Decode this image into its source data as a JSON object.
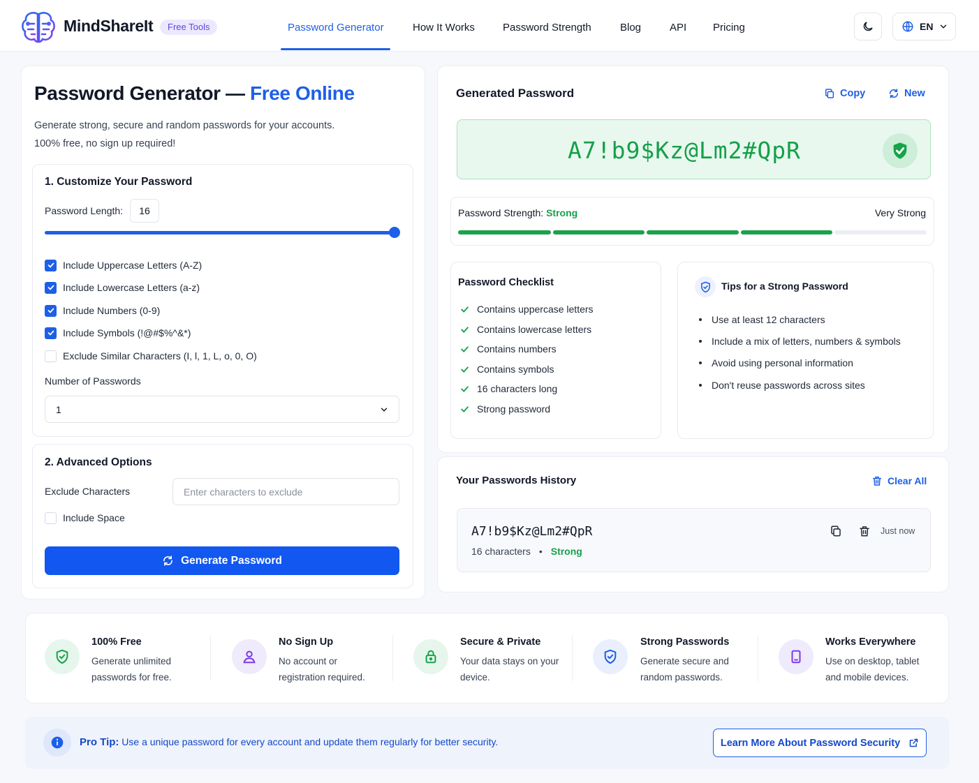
{
  "header": {
    "brand": "MindShareIt",
    "badge": "Free Tools",
    "nav": [
      "Password Generator",
      "How It Works",
      "Password Strength",
      "Blog",
      "API",
      "Pricing"
    ],
    "language": "EN"
  },
  "intro": {
    "title": "Password Generator —",
    "title_accent": "Free Online",
    "lead_line1": "Generate strong, secure and random passwords for your accounts.",
    "lead_line2": "100% free, no sign up required!"
  },
  "customize": {
    "title": "1. Customize Your Password",
    "length_label": "Password Length:",
    "length_value": "16",
    "slider_fraction": 1.0,
    "options": [
      {
        "label": "Include Uppercase Letters (A-Z)",
        "checked": true
      },
      {
        "label": "Include Lowercase Letters (a-z)",
        "checked": true
      },
      {
        "label": "Include Numbers (0-9)",
        "checked": true
      },
      {
        "label": "Include Symbols (!@#$%^&*)",
        "checked": true
      },
      {
        "label": "Exclude Similar Characters (I, l, 1, L, o, 0, O)",
        "checked": false
      }
    ],
    "count_label": "Number of Passwords",
    "count_value": "1"
  },
  "advanced": {
    "title": "2. Advanced Options",
    "exclude_label": "Exclude Characters",
    "exclude_placeholder": "Enter characters to exclude",
    "space_label": "Include Space",
    "space_checked": false,
    "generate_label": "Generate Password"
  },
  "generated": {
    "title": "Generated Password",
    "copy_label": "Copy",
    "new_label": "New",
    "password": "A7!b9$Kz@Lm2#QpR",
    "strength_label": "Password Strength:",
    "strength_value": "Strong",
    "strength_max": "Very Strong",
    "strength_filled_segments": 4,
    "strength_total_segments": 5
  },
  "checklist": {
    "title": "Password Checklist",
    "items": [
      "Contains uppercase letters",
      "Contains lowercase letters",
      "Contains numbers",
      "Contains symbols",
      "16 characters long",
      "Strong password"
    ]
  },
  "tips": {
    "title": "Tips for a Strong Password",
    "items": [
      "Use at least 12 characters",
      "Include a mix of letters, numbers & symbols",
      "Avoid using personal information",
      "Don't reuse passwords across sites"
    ]
  },
  "history": {
    "title": "Your Passwords History",
    "clear_label": "Clear All",
    "entry": {
      "password": "A7!b9$Kz@Lm2#QpR",
      "length": "16 characters",
      "separator": "•",
      "strength": "Strong",
      "time": "Just now"
    }
  },
  "features": [
    {
      "title": "100% Free",
      "desc": "Generate unlimited passwords for free.",
      "icon": "shield-check-icon"
    },
    {
      "title": "No Sign Up",
      "desc": "No account or registration required.",
      "icon": "user-icon"
    },
    {
      "title": "Secure & Private",
      "desc": "Your data stays on your device.",
      "icon": "lock-icon"
    },
    {
      "title": "Strong Passwords",
      "desc": "Generate secure and random passwords.",
      "icon": "shield-icon"
    },
    {
      "title": "Works Everywhere",
      "desc": "Use on desktop, tablet and mobile devices.",
      "icon": "tablet-icon"
    }
  ],
  "protip": {
    "label": "Pro Tip:",
    "text": "Use a unique password for every account and update them regularly for better security.",
    "button": "Learn More About Password Security"
  },
  "colors": {
    "primary": "#1d5fe8",
    "success": "#15a04a",
    "accent_purple": "#5b46e0"
  }
}
